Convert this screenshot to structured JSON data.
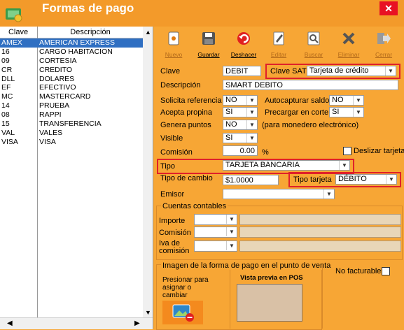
{
  "window": {
    "title": "Formas de pago",
    "close_label": "✕"
  },
  "list": {
    "headers": {
      "clave": "Clave",
      "descripcion": "Descripción"
    },
    "rows": [
      {
        "clave": "AMEX",
        "desc": "AMERICAN EXPRESS",
        "selected": true
      },
      {
        "clave": "16",
        "desc": "CARGO HABITACION"
      },
      {
        "clave": "09",
        "desc": "CORTESIA"
      },
      {
        "clave": "CR",
        "desc": "CREDITO"
      },
      {
        "clave": "DLL",
        "desc": "DOLARES"
      },
      {
        "clave": "EF",
        "desc": "EFECTIVO"
      },
      {
        "clave": "MC",
        "desc": "MASTERCARD"
      },
      {
        "clave": "14",
        "desc": "PRUEBA"
      },
      {
        "clave": "08",
        "desc": "RAPPI"
      },
      {
        "clave": "15",
        "desc": "TRANSFERENCIA"
      },
      {
        "clave": "VAL",
        "desc": "VALES"
      },
      {
        "clave": "VISA",
        "desc": "VISA"
      }
    ]
  },
  "toolbar": {
    "nuevo": "Nuevo",
    "guardar": "Guardar",
    "deshacer": "Deshacer",
    "editar": "Editar",
    "buscar": "Buscar",
    "eliminar": "Eliminar",
    "cerrar": "Cerrar"
  },
  "form": {
    "clave_label": "Clave",
    "clave_value": "DEBIT",
    "clave_sat_label": "Clave SAT",
    "clave_sat_value": "Tarjeta de crédito",
    "descripcion_label": "Descripción",
    "descripcion_value": "SMART DEBITO",
    "solicita_ref_label": "Solicita referencia",
    "solicita_ref_value": "NO",
    "autocaptura_label": "Autocapturar saldo",
    "autocaptura_value": "NO",
    "acepta_propina_label": "Acepta propina",
    "acepta_propina_value": "SI",
    "precargar_label": "Precargar en corte",
    "precargar_value": "SI",
    "genera_puntos_label": "Genera puntos",
    "genera_puntos_value": "NO",
    "monedero_note": "(para monedero electrónico)",
    "visible_label": "Visible",
    "visible_value": "SI",
    "comision_label": "Comisión",
    "comision_value": "0.00",
    "comision_unit": "%",
    "deslizar_label": "Deslizar tarjeta",
    "tipo_label": "Tipo",
    "tipo_value": "TARJETA BANCARIA",
    "tipo_cambio_label": "Tipo de cambio",
    "tipo_cambio_value": "$1.0000",
    "tipo_tarjeta_label": "Tipo tarjeta",
    "tipo_tarjeta_value": "DÉBITO",
    "emisor_label": "Emisor",
    "emisor_value": ""
  },
  "cuentas": {
    "title": "Cuentas contables",
    "importe": "Importe",
    "comision": "Comisión",
    "iva_line1": "Iva de",
    "iva_line2": "comisión"
  },
  "imagen": {
    "title": "Imagen de la forma de pago en el punto de venta",
    "presionar_l1": "Presionar para",
    "presionar_l2": "asignar o",
    "presionar_l3": "cambiar",
    "vista_previa": "Vista previa en POS",
    "no_facturable": "No facturable"
  },
  "colors": {
    "background": "#f7a635",
    "highlight_border": "#e0202a",
    "selection": "#2f6fc2"
  }
}
